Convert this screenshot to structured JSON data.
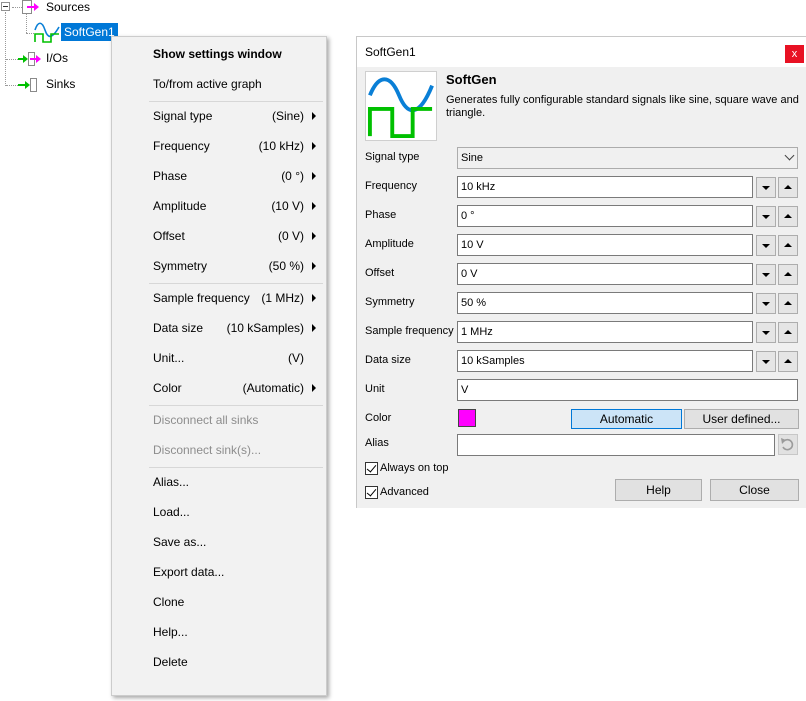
{
  "tree": {
    "nodes": [
      {
        "label": "Sources",
        "expander": "minus",
        "icon": "arrow-magenta-icon"
      },
      {
        "label": "SoftGen1",
        "selected": true,
        "icon": "waveform-icon"
      },
      {
        "label": "I/Os",
        "icon": "arrow-green-magenta-icon"
      },
      {
        "label": "Sinks",
        "icon": "arrow-green-icon"
      }
    ]
  },
  "context_menu": {
    "items": [
      {
        "label": "Show settings window",
        "bold": true
      },
      {
        "label": "To/from active graph"
      },
      {
        "sep": true
      },
      {
        "label": "Signal type",
        "value": "(Sine)",
        "submenu": true
      },
      {
        "label": "Frequency",
        "value": "(10 kHz)",
        "submenu": true
      },
      {
        "label": "Phase",
        "value": "(0 °)",
        "submenu": true
      },
      {
        "label": "Amplitude",
        "value": "(10 V)",
        "submenu": true
      },
      {
        "label": "Offset",
        "value": "(0 V)",
        "submenu": true
      },
      {
        "label": "Symmetry",
        "value": "(50 %)",
        "submenu": true
      },
      {
        "sep": true
      },
      {
        "label": "Sample frequency",
        "value": "(1 MHz)",
        "submenu": true
      },
      {
        "label": "Data size",
        "value": "(10 kSamples)",
        "submenu": true
      },
      {
        "label": "Unit...",
        "value": "(V)"
      },
      {
        "label": "Color",
        "value": "(Automatic)",
        "submenu": true
      },
      {
        "sep": true
      },
      {
        "label": "Disconnect all sinks",
        "disabled": true
      },
      {
        "label": "Disconnect sink(s)...",
        "disabled": true
      },
      {
        "sep": true
      },
      {
        "label": "Alias..."
      },
      {
        "label": "Load..."
      },
      {
        "label": "Save as..."
      },
      {
        "label": "Export data..."
      },
      {
        "label": "Clone"
      },
      {
        "label": "Help..."
      },
      {
        "label": "Delete"
      }
    ]
  },
  "window": {
    "title": "SoftGen1",
    "close_glyph": "x",
    "app_name": "SoftGen",
    "description": "Generates fully configurable standard signals like sine, square wave and triangle.",
    "fields": {
      "signal_type": {
        "label": "Signal type",
        "value": "Sine"
      },
      "frequency": {
        "label": "Frequency",
        "value": "10 kHz"
      },
      "phase": {
        "label": "Phase",
        "value": "0 °"
      },
      "amplitude": {
        "label": "Amplitude",
        "value": "10 V"
      },
      "offset": {
        "label": "Offset",
        "value": "0 V"
      },
      "symmetry": {
        "label": "Symmetry",
        "value": "50 %"
      },
      "sample_frequency": {
        "label": "Sample frequency",
        "value": "1 MHz"
      },
      "data_size": {
        "label": "Data size",
        "value": "10 kSamples"
      },
      "unit": {
        "label": "Unit",
        "value": "V"
      },
      "color": {
        "label": "Color",
        "swatch": "#ff00ff",
        "automatic_label": "Automatic",
        "user_defined_label": "User defined..."
      },
      "alias": {
        "label": "Alias",
        "value": ""
      }
    },
    "always_on_top": {
      "label": "Always on top",
      "checked": true
    },
    "advanced": {
      "label": "Advanced",
      "checked": true
    },
    "help_label": "Help",
    "close_label": "Close"
  },
  "colors": {
    "accent": "#0078d7",
    "magenta": "#ff00ff",
    "green": "#00c000",
    "sine_blue": "#0a7fd6"
  }
}
